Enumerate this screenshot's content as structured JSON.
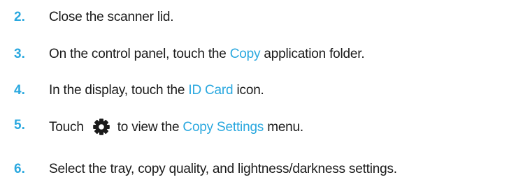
{
  "steps": [
    {
      "number": "2.",
      "text_before": "Close the scanner lid."
    },
    {
      "number": "3.",
      "text_before": "On the control panel, touch the ",
      "link": "Copy",
      "text_after": " application folder."
    },
    {
      "number": "4.",
      "text_before": "In the display, touch the ",
      "link": "ID Card",
      "text_after": " icon."
    },
    {
      "number": "5.",
      "text_before": "Touch",
      "icon": "gear-icon",
      "text_middle": "to view the ",
      "link": "Copy Settings",
      "text_after": " menu."
    },
    {
      "number": "6.",
      "text_before": "Select the tray, copy quality, and lightness/darkness settings."
    }
  ],
  "colors": {
    "accent": "#2aa8df",
    "text": "#1a1a1a"
  }
}
